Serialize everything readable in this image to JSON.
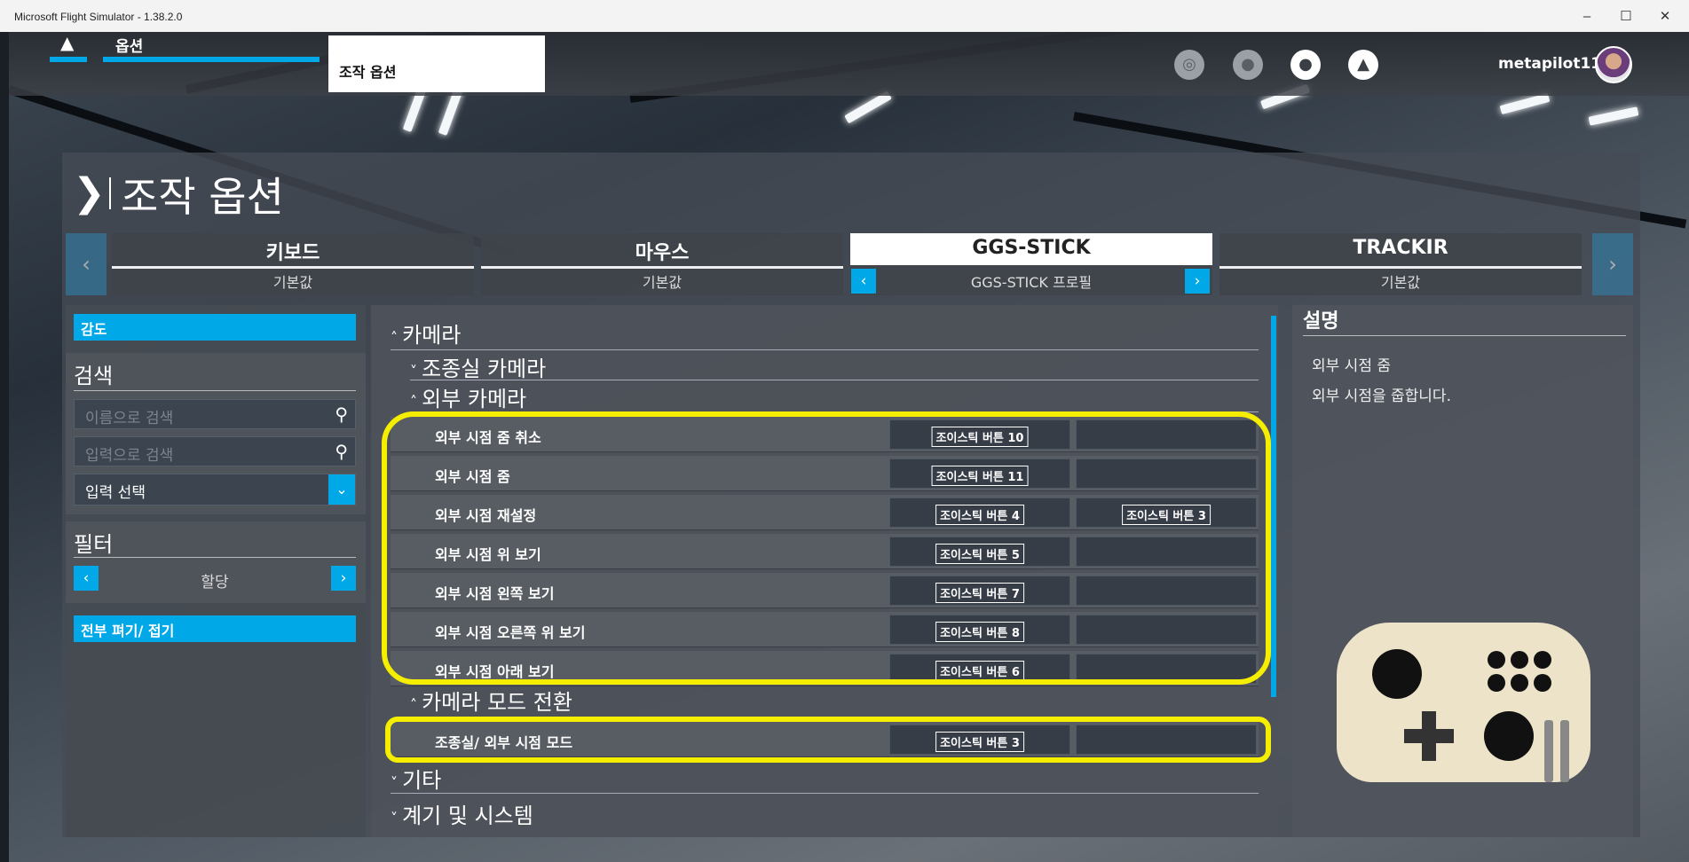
{
  "window": {
    "title": "Microsoft Flight Simulator - 1.38.2.0",
    "minimize": "–",
    "maximize": "☐",
    "close": "✕"
  },
  "topnav": {
    "home_icon": "home-icon",
    "options_label": "옵션",
    "current_tab": "조작 옵션",
    "icons": [
      "wheel-icon",
      "people-icon",
      "profile-icon",
      "bell-icon"
    ],
    "username": "metapilot11"
  },
  "page": {
    "title": "조작 옵션"
  },
  "devices": [
    {
      "name": "키보드",
      "profile": "기본값"
    },
    {
      "name": "마우스",
      "profile": "기본값"
    },
    {
      "name": "GGS-STICK",
      "profile": "GGS-STICK 프로필"
    },
    {
      "name": "TRACKIR",
      "profile": "기본값"
    }
  ],
  "left": {
    "sensitivity_button": "감도",
    "search_heading": "검색",
    "search_name_placeholder": "이름으로 검색",
    "search_input_placeholder": "입력으로 검색",
    "input_select": "입력 선택",
    "filter_heading": "필터",
    "filter_value": "할당",
    "expand_collapse": "전부 펴기/ 접기"
  },
  "tree": {
    "camera": "카메라",
    "cockpit_camera": "조종실 카메라",
    "external_camera": "외부 카메라",
    "camera_mode": "카메라 모드 전환",
    "misc": "기타",
    "instruments": "계기 및 시스템"
  },
  "bindings_external": [
    {
      "name": "외부 시점 줌 취소",
      "slot1": "조이스틱 버튼 10",
      "slot2": ""
    },
    {
      "name": "외부 시점 줌",
      "slot1": "조이스틱 버튼 11",
      "slot2": ""
    },
    {
      "name": "외부 시점 재설정",
      "slot1": "조이스틱 버튼 4",
      "slot2": "조이스틱 버튼 3"
    },
    {
      "name": "외부 시점 위 보기",
      "slot1": "조이스틱 버튼 5",
      "slot2": ""
    },
    {
      "name": "외부 시점 왼쪽 보기",
      "slot1": "조이스틱 버튼 7",
      "slot2": ""
    },
    {
      "name": "외부 시점 오른쪽 위 보기",
      "slot1": "조이스틱 버튼 8",
      "slot2": ""
    },
    {
      "name": "외부 시점 아래 보기",
      "slot1": "조이스틱 버튼 6",
      "slot2": ""
    }
  ],
  "bindings_mode": [
    {
      "name": "조종실/ 외부 시점 모드",
      "slot1": "조이스틱 버튼 3",
      "slot2": ""
    }
  ],
  "description": {
    "heading": "설명",
    "item": "외부 시점 줌",
    "text": "외부 시점을 줍합니다."
  },
  "colors": {
    "accent": "#00a8e8",
    "highlight": "#f6ee00"
  }
}
